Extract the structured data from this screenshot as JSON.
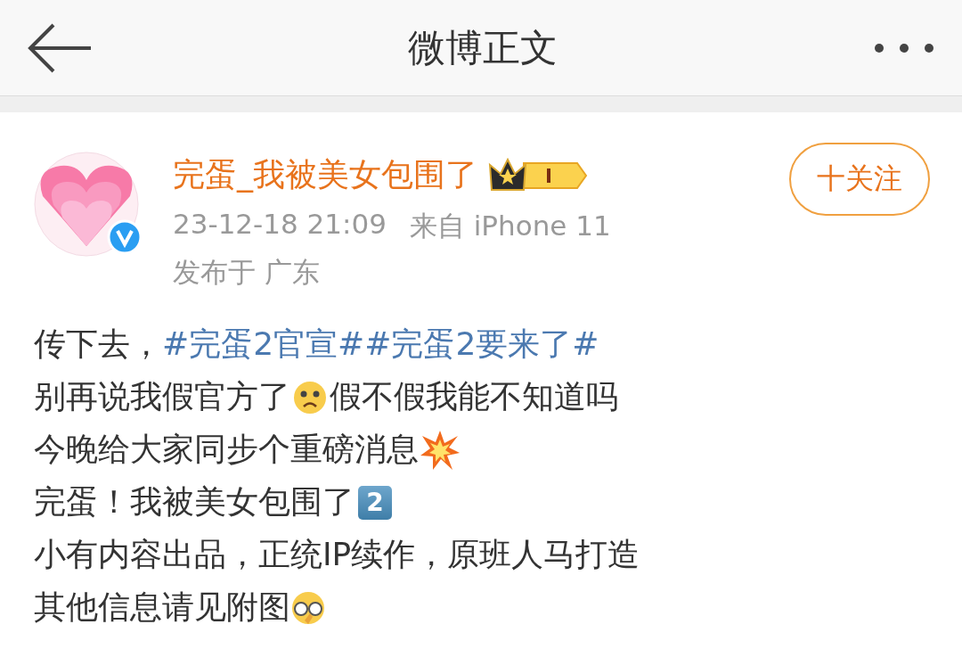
{
  "header": {
    "title": "微博正文"
  },
  "post": {
    "author": "完蛋_我被美女包围了",
    "verified": true,
    "follow_button": "十关注",
    "timestamp": "23-12-18 21:09",
    "source": "来自 iPhone 11",
    "location": "发布于 广东",
    "lines": [
      [
        {
          "kind": "text",
          "text": "传下去，"
        },
        {
          "kind": "topic",
          "text": "#完蛋2官宣#"
        },
        {
          "kind": "topic",
          "text": "#完蛋2要来了#"
        }
      ],
      [
        {
          "kind": "text",
          "text": "别再说我假官方了"
        },
        {
          "kind": "sadface"
        },
        {
          "kind": "text",
          "text": "假不假我能不知道吗"
        }
      ],
      [
        {
          "kind": "text",
          "text": "今晚给大家同步个重磅消息"
        },
        {
          "kind": "explosion"
        }
      ],
      [
        {
          "kind": "text",
          "text": "完蛋！我被美女包围了"
        },
        {
          "kind": "keycap",
          "text": "2"
        }
      ],
      [
        {
          "kind": "text",
          "text": "小有内容出品，正统IP续作，原班人马打造"
        }
      ],
      [
        {
          "kind": "text",
          "text": "其他信息请见附图"
        },
        {
          "kind": "glassesface"
        }
      ]
    ]
  }
}
